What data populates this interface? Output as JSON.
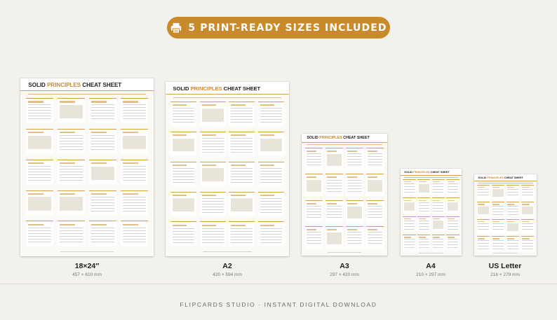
{
  "banner": {
    "text": "5 PRINT-READY SIZES INCLUDED",
    "icon": "printer-icon",
    "color": "#c98a2c"
  },
  "poster_title": {
    "lead": "SOLID",
    "accent": "PRINCIPLES",
    "tail": "CHEAT SHEET"
  },
  "sizes": [
    {
      "name": "18×24″",
      "dims": "457 × 610 mm"
    },
    {
      "name": "A2",
      "dims": "420 × 594 mm"
    },
    {
      "name": "A3",
      "dims": "297 × 420 mm"
    },
    {
      "name": "A4",
      "dims": "210 × 297 mm"
    },
    {
      "name": "US Letter",
      "dims": "216 × 279 mm"
    }
  ],
  "footer": {
    "text": "FLIPCARDS STUDIO · INSTANT DIGITAL DOWNLOAD"
  },
  "colors": {
    "accent": "#c98a2c",
    "background": "#f3f1ec"
  }
}
